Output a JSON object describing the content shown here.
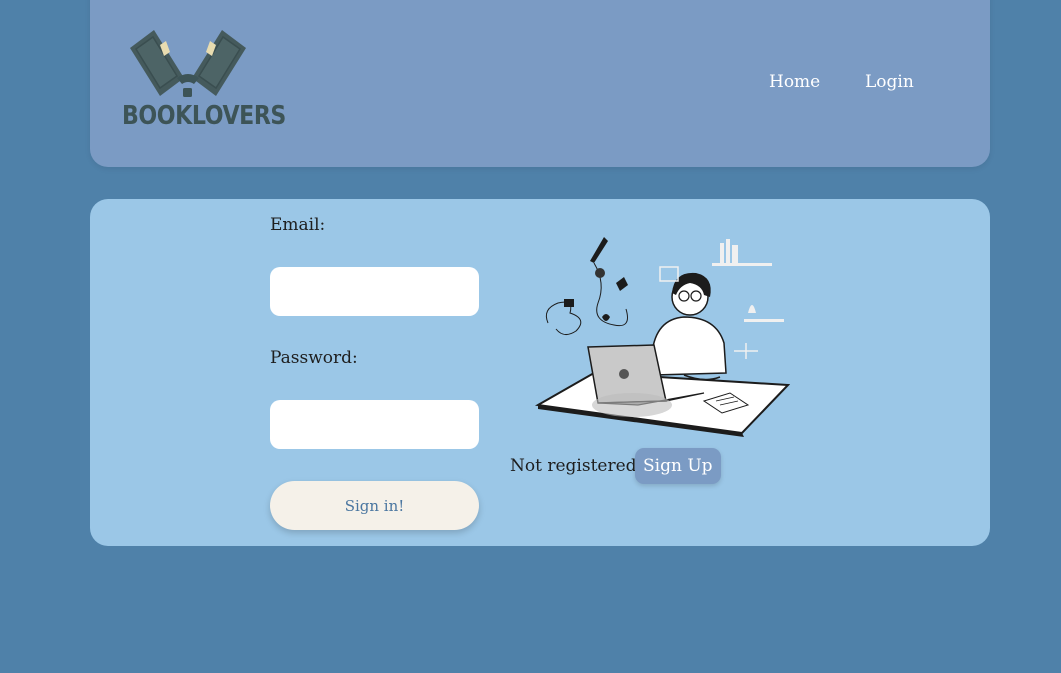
{
  "header": {
    "logo_text": "BOOKLOVERS",
    "nav": {
      "home": "Home",
      "login": "Login"
    }
  },
  "login_form": {
    "email_label": "Email:",
    "email_value": "",
    "password_label": "Password:",
    "password_value": "",
    "submit_label": "Sign in!"
  },
  "signup": {
    "prompt": "Not registered?",
    "button_label": "Sign Up"
  },
  "colors": {
    "page_background": "#4f81a9",
    "header_background": "#7b9bc4",
    "card_background": "#9bc7e7",
    "signin_background": "#f5f1e9",
    "signup_background": "#7b9bc4",
    "logo": "#3d5457"
  },
  "icons": {
    "logo": "open-book-logo",
    "illustration": "person-at-laptop-illustration"
  }
}
